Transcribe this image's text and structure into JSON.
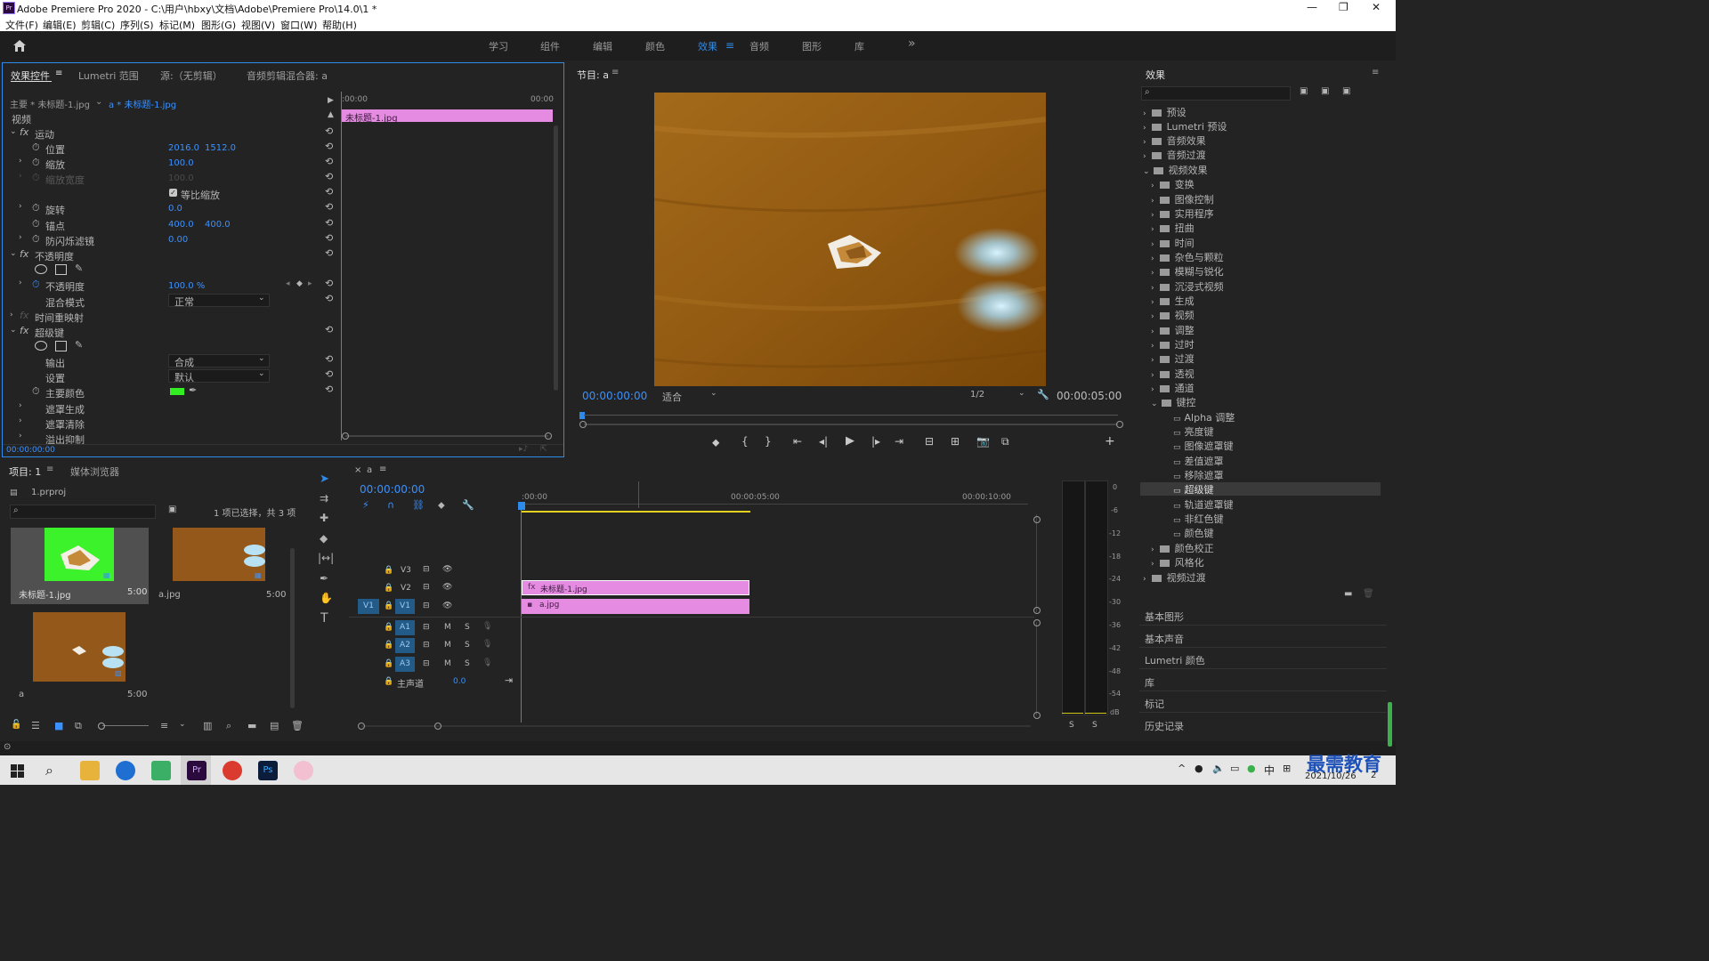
{
  "window": {
    "title": "Adobe Premiere Pro 2020 - C:\\用户\\hbxy\\文档\\Adobe\\Premiere Pro\\14.0\\1 *",
    "logo": "Pr",
    "min_label": "—",
    "max_label": "❐",
    "close_label": "✕"
  },
  "menu": [
    "文件(F)",
    "编辑(E)",
    "剪辑(C)",
    "序列(S)",
    "标记(M)",
    "图形(G)",
    "视图(V)",
    "窗口(W)",
    "帮助(H)"
  ],
  "workspaces": {
    "items": [
      "学习",
      "组件",
      "编辑",
      "颜色",
      "效果",
      "音频",
      "图形",
      "库"
    ],
    "active": "效果",
    "more": "»"
  },
  "effect_controls": {
    "tabs": [
      "效果控件",
      "Lumetri 范围",
      "源:（无剪辑）",
      "音频剪辑混合器: a"
    ],
    "source_label": "主要 * 未标题-1.jpg",
    "clip_label": "a * 未标题-1.jpg",
    "tc_start": ":00:00",
    "tc_end": "00:00",
    "clip_name": "未标题-1.jpg",
    "section_video": "视频",
    "motion": "运动",
    "position": "位置",
    "position_x": "2016.0",
    "position_y": "1512.0",
    "scale": "缩放",
    "scale_val": "100.0",
    "scale_width": "缩放宽度",
    "scale_width_val": "100.0",
    "uniform_scale": "等比缩放",
    "rotation": "旋转",
    "rotation_val": "0.0",
    "anchor": "锚点",
    "anchor_x": "400.0",
    "anchor_y": "400.0",
    "flicker": "防闪烁滤镜",
    "flicker_val": "0.00",
    "opacity": "不透明度",
    "opacity_prop": "不透明度",
    "opacity_val": "100.0 %",
    "blend_mode": "混合模式",
    "blend_val": "正常",
    "time_remap": "时间重映射",
    "ultra_key": "超级键",
    "output": "输出",
    "output_val": "合成",
    "settings": "设置",
    "settings_val": "默认",
    "key_color": "主要颜色",
    "key_color_hex": "#33ee22",
    "matte_gen": "遮罩生成",
    "matte_clean": "遮罩清除",
    "spill": "溢出抑制",
    "timecode": "00:00:00:00"
  },
  "program_monitor": {
    "title": "节目: a",
    "timecode": "00:00:00:00",
    "fit": "适合",
    "resolution": "1/2",
    "duration": "00:00:05:00"
  },
  "project": {
    "tabs": [
      "项目: 1",
      "媒体浏览器"
    ],
    "project_file": "1.prproj",
    "selection_info": "1 项已选择，共 3 项",
    "items": [
      {
        "name": "未标题-1.jpg",
        "duration": "5:00"
      },
      {
        "name": "a.jpg",
        "duration": "5:00"
      },
      {
        "name": "a",
        "duration": "5:00"
      }
    ]
  },
  "timeline": {
    "sequence": "a",
    "timecode": "00:00:00:00",
    "ruler": [
      ":00:00",
      "00:00:05:00",
      "00:00:10:00"
    ],
    "video_tracks": [
      "V3",
      "V2",
      "V1"
    ],
    "v1_source": "V1",
    "audio_tracks": [
      "A1",
      "A2",
      "A3"
    ],
    "master": "主声道",
    "master_val": "0.0",
    "clip_v2": "未标题-1.jpg",
    "clip_v1": "a.jpg",
    "m_label": "M",
    "s_label": "S"
  },
  "audio_meter": {
    "scale": [
      "0",
      "-6",
      "-12",
      "-18",
      "-24",
      "-30",
      "-36",
      "-42",
      "-48",
      "-54",
      "dB"
    ],
    "solo": [
      "S",
      "S"
    ]
  },
  "effects_panel": {
    "title": "效果",
    "top_items": [
      "预设",
      "Lumetri 预设",
      "音频效果",
      "音频过渡",
      "视频效果"
    ],
    "video_effects": [
      "变换",
      "图像控制",
      "实用程序",
      "扭曲",
      "时间",
      "杂色与颗粒",
      "模糊与锐化",
      "沉浸式视频",
      "生成",
      "视频",
      "调整",
      "过时",
      "过渡",
      "透视",
      "通道",
      "键控"
    ],
    "keying": [
      "Alpha 调整",
      "亮度键",
      "图像遮罩键",
      "差值遮罩",
      "移除遮罩",
      "超级键",
      "轨道遮罩键",
      "非红色键",
      "颜色键"
    ],
    "after_keying": [
      "颜色校正",
      "风格化"
    ],
    "last": "视频过渡",
    "selected": "超级键"
  },
  "side_panels": [
    "基本图形",
    "基本声音",
    "Lumetri 颜色",
    "库",
    "标记",
    "历史记录"
  ],
  "taskbar": {
    "ime": "中",
    "date": "2021/10/26",
    "watermark": "最需教育",
    "notify_count": "2"
  }
}
